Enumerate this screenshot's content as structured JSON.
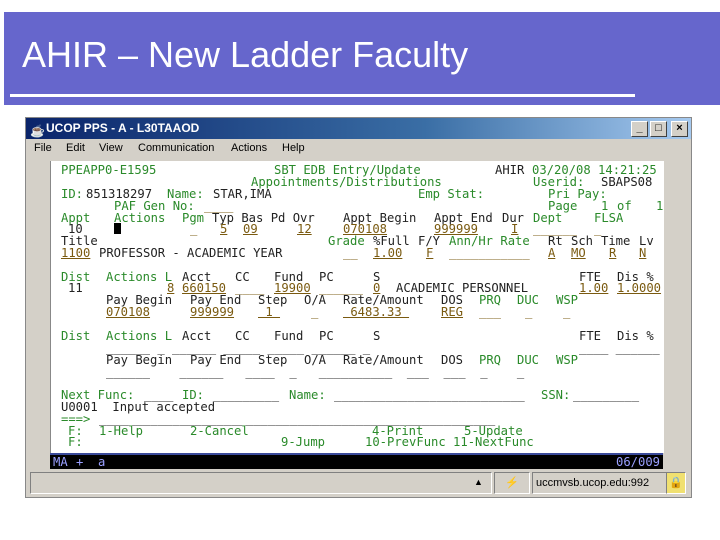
{
  "slide": {
    "title": "AHIR – New Ladder Faculty"
  },
  "window": {
    "title": "UCOP PPS - A - L30TAAOD",
    "minimize": "_",
    "maximize": "□",
    "close": "×",
    "menu": [
      "File",
      "Edit",
      "View",
      "Communication",
      "Actions",
      "Help"
    ]
  },
  "colors": {
    "band": "#6666cc",
    "terminal_label": "#2a8a2a",
    "terminal_value": "#7a5a10"
  },
  "terminal": {
    "screen_id": "PPEAPP0-E1595",
    "screen_title": "SBT EDB Entry/Update",
    "system": "AHIR",
    "datetime": "03/20/08 14:21:25",
    "subtitle": "Appointments/Distributions",
    "userid_label": "Userid:",
    "userid": "SBAPS08",
    "id_label": "ID:",
    "id": "851318297",
    "name_label": "Name:",
    "name": "STAR,IMA",
    "emp_stat_label": "Emp Stat:",
    "pri_pay_label": "Pri Pay:",
    "paf_label": "PAF Gen No:",
    "paf_value": "____",
    "page_label": "Page",
    "page": "1",
    "of_label": "of",
    "page_total": "1",
    "appt_headers": {
      "appt": "Appt",
      "actions": "Actions",
      "pgm": "Pgm",
      "typ": "Typ Bas Pd Ovr",
      "begin": "Appt Begin",
      "end": "Appt End",
      "dur": "Dur",
      "dept": "Dept",
      "flsa": "FLSA"
    },
    "appt_values": {
      "appt": "10",
      "pgm": "_",
      "typ": "5",
      "bas": "09",
      "ovr": "12",
      "begin": "070108",
      "end": "999999",
      "dur": "I",
      "dept": "______",
      "flsa": "_"
    },
    "title_headers": {
      "title": "Title",
      "grade": "Grade",
      "full": "%Full",
      "fy": "F/Y",
      "rate": "Ann/Hr Rate",
      "rt": "Rt",
      "sch": "Sch",
      "time": "Time",
      "lv": "Lv"
    },
    "title_values": {
      "code": "1100",
      "name": "PROFESSOR - ACADEMIC YEAR",
      "grade": "__",
      "full": "1.00",
      "fy": "F",
      "rate": "___________",
      "rt": "A",
      "sch": "MO",
      "time": "R",
      "lv": "N"
    },
    "dist_headers": {
      "dist": "Dist",
      "actions": "Actions L",
      "acct": "Acct",
      "cc": "CC",
      "fund": "Fund",
      "pc": "PC",
      "s": "S",
      "fte": "FTE",
      "dis": "Dis %"
    },
    "dist1": {
      "dist": "11",
      "l": "8",
      "acct": "660150",
      "cc": "____",
      "fund": "19900",
      "pc": "______",
      "s": "0",
      "desc": "ACADEMIC PERSONNEL",
      "fte": "1.00",
      "dis": "1.0000"
    },
    "pay_headers": {
      "begin": "Pay Begin",
      "end": "Pay End",
      "step": "Step",
      "oa": "O/A",
      "rate": "Rate/Amount",
      "dos": "DOS",
      "prq": "PRQ",
      "duc": "DUC",
      "wsp": "WSP"
    },
    "pay1": {
      "begin": "070108",
      "end": "999999",
      "step": " 1 ",
      "oa": "_",
      "rate": " 6483.33 ",
      "dos": "REG",
      "prq": "___",
      "duc": "_",
      "wsp": "_"
    },
    "dist2_blank": "______ _ ______ _____ _____ ______ _",
    "dist2_fte_blank": "____ ______",
    "pay2_blank": "______    ______   ____  _   __________  ___  ___  _    _",
    "next_func_label": "Next Func:",
    "next_func": "____",
    "nf_id_label": "ID:",
    "nf_id": "_________",
    "nf_name_label": "Name:",
    "nf_name": "__________________________",
    "ssn_label": "SSN:",
    "ssn": "_________",
    "message": "U0001  Input accepted",
    "prompt": "===>",
    "command": "______________________________________________________",
    "fkeys1": {
      "f": "F:",
      "k1": "1-Help",
      "k2": "2-Cancel",
      "k4": "4-Print",
      "k5": "5-Update"
    },
    "fkeys2": {
      "f": "F:",
      "k9": "9-Jump",
      "k10": "10-PrevFunc 11-NextFunc"
    },
    "oia": {
      "mode": "MA",
      "plus": "+",
      "a": "a",
      "position": "06/009"
    }
  },
  "statusbar": {
    "host": "uccmvsb.ucop.edu:992"
  }
}
